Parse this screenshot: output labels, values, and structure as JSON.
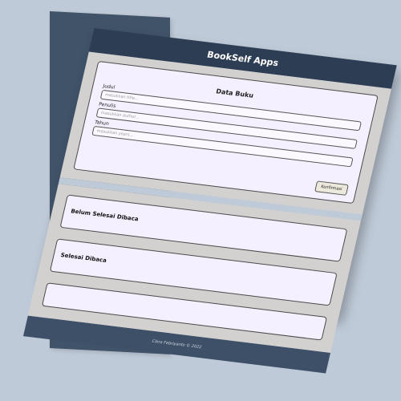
{
  "header": {
    "title": "BookSelf Apps"
  },
  "form": {
    "heading": "Data Buku",
    "fields": [
      {
        "label": "Judul",
        "placeholder": "masukkan title..."
      },
      {
        "label": "Penulis",
        "placeholder": "masukkan author..."
      },
      {
        "label": "Tahun",
        "placeholder": "masukkan years..."
      }
    ],
    "submit_label": "Konfirmasi"
  },
  "shelves": [
    {
      "title": "Belum Selesai Dibaca"
    },
    {
      "title": "Selesai Dibaca"
    }
  ],
  "footer": {
    "text": "Cikra Febriyanto © 2022"
  }
}
